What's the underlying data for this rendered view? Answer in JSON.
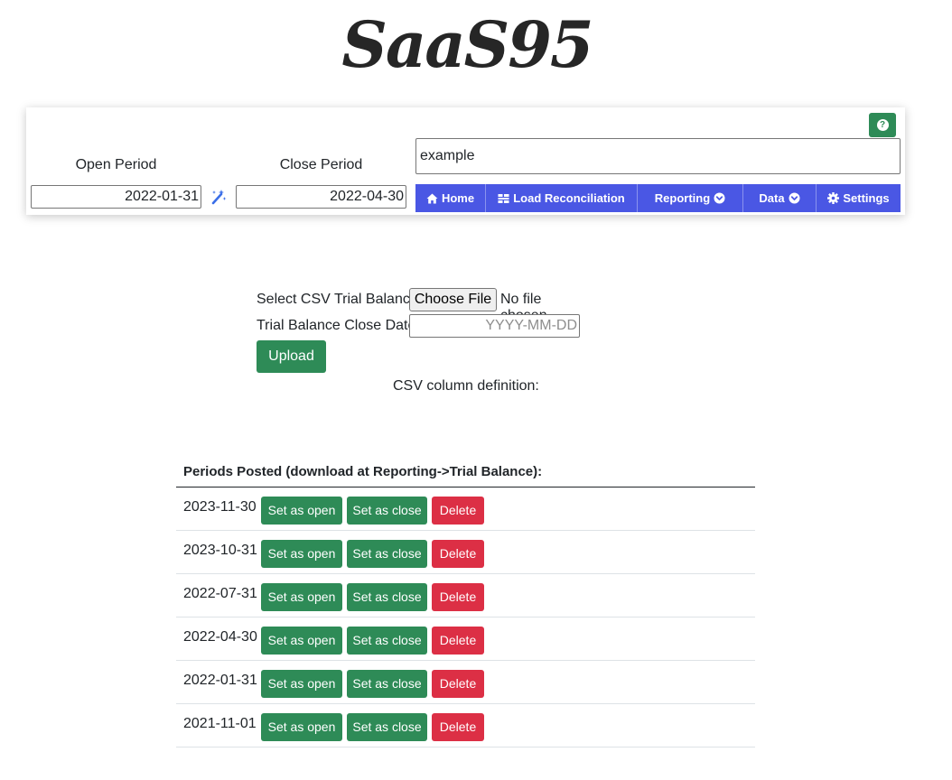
{
  "app": {
    "logo": "SaaS95"
  },
  "panel": {
    "help_label": "?",
    "open_period": {
      "label": "Open Period",
      "value": "2022-01-31"
    },
    "close_period": {
      "label": "Close Period",
      "value": "2022-04-30"
    },
    "search": {
      "value": "example"
    },
    "nav": [
      {
        "label": "Home",
        "icon": "home-icon"
      },
      {
        "label": "Load Reconciliation",
        "icon": "load-icon"
      },
      {
        "label": "Reporting",
        "icon": "chevron-down-circle-icon"
      },
      {
        "label": "Data",
        "icon": "chevron-down-circle-icon"
      },
      {
        "label": "Settings",
        "icon": "gear-icon"
      }
    ],
    "colors": {
      "nav_bg": "#4a57e4",
      "primary": "#2e8b57",
      "danger": "#dc2f45"
    }
  },
  "upload": {
    "csv_label": "Select CSV Trial Balance",
    "choose_file": "Choose File",
    "no_file": "No file chosen",
    "close_date_label": "Trial Balance Close Date",
    "close_date_placeholder": "YYYY-MM-DD",
    "upload_button": "Upload",
    "csv_definition": "CSV column definition:"
  },
  "periods": {
    "header": "Periods Posted (download at Reporting->Trial Balance):",
    "set_open_label": "Set as open",
    "set_close_label": "Set as close",
    "delete_label": "Delete",
    "rows": [
      {
        "date": "2023-11-30"
      },
      {
        "date": "2023-10-31"
      },
      {
        "date": "2022-07-31"
      },
      {
        "date": "2022-04-30"
      },
      {
        "date": "2022-01-31"
      },
      {
        "date": "2021-11-01"
      }
    ]
  }
}
